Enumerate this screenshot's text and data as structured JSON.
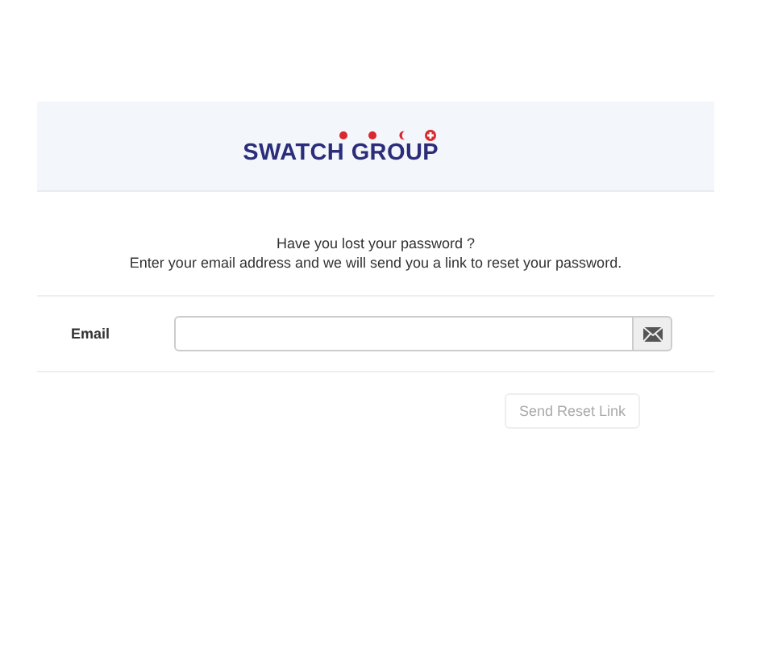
{
  "logo": {
    "text": "SWATCH GROUP"
  },
  "intro": {
    "title": "Have you lost your password ?",
    "text": "Enter your email address and we will send you a link to reset your password."
  },
  "form": {
    "label": "Email"
  },
  "button": {
    "label": "Send Reset Link",
    "disabled": true
  }
}
